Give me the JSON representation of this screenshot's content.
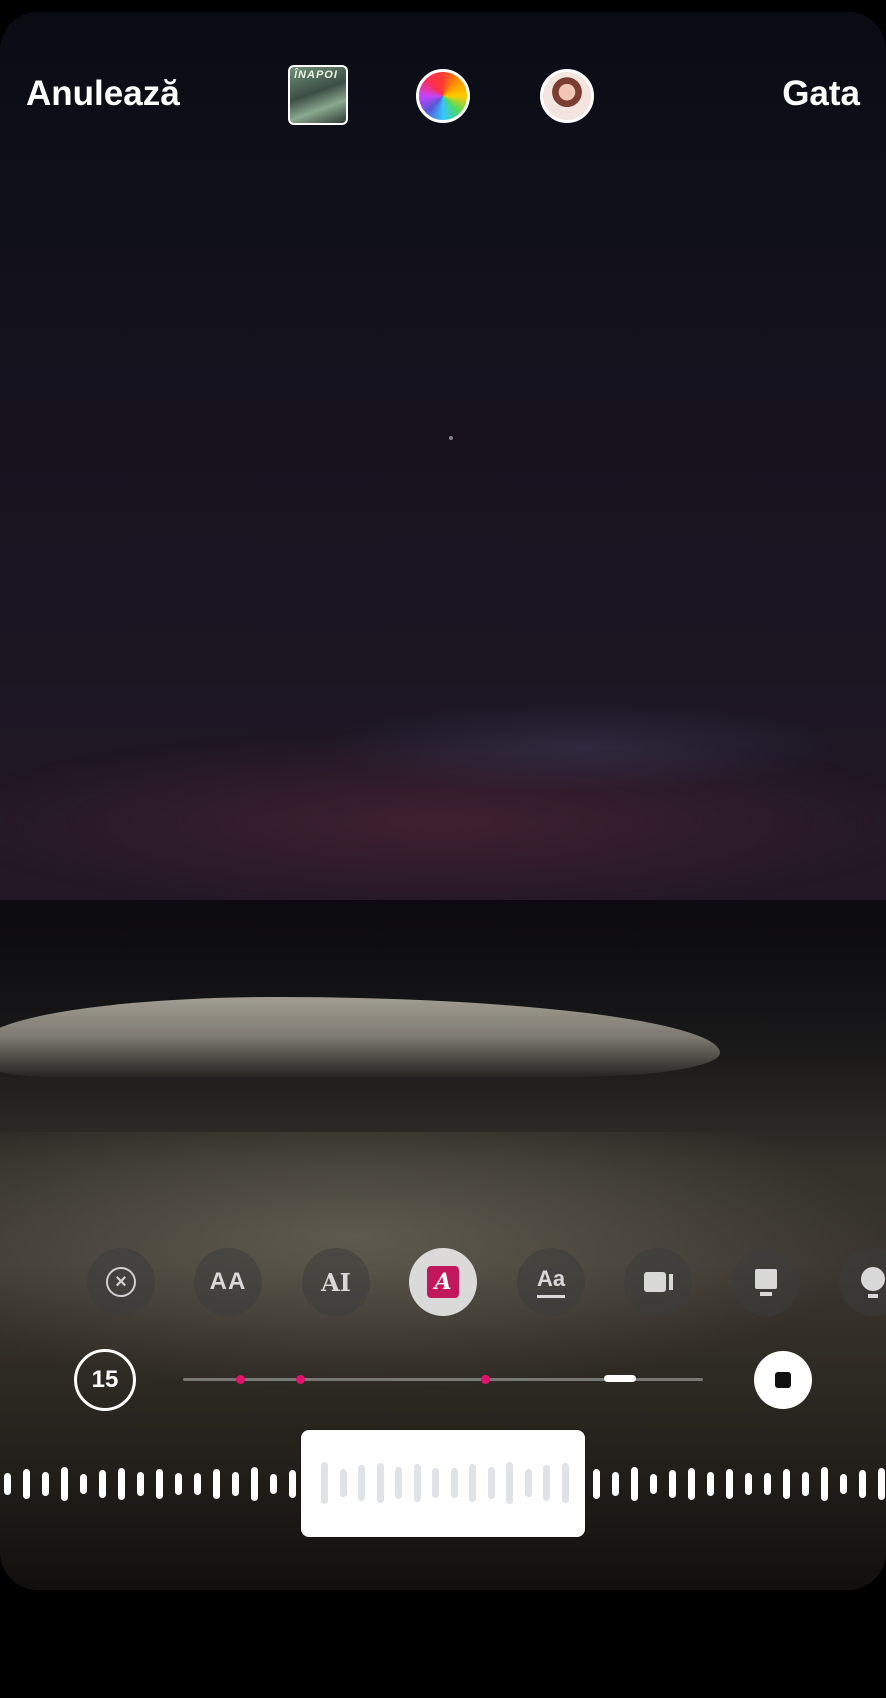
{
  "header": {
    "cancel_label": "Anulează",
    "done_label": "Gata",
    "thumbnail_text": "ÎNAPOI"
  },
  "toolbar": {
    "items": [
      "remove-icon",
      "text-size-icon",
      "text-highlight-icon",
      "text-style-box-icon",
      "text-underline-icon",
      "camera-icon",
      "card-icon",
      "bulb-icon"
    ],
    "selected": "text-style-box-icon",
    "aa_label": "AA",
    "ai_label": "AI",
    "a_label": "A",
    "aa_small_label": "Aa"
  },
  "timeline": {
    "duration": "15",
    "marker_positions": [
      0.11,
      0.225,
      0.58
    ],
    "progress_position": 0.84
  },
  "colors": {
    "accent": "#e3116c",
    "selected_tool_bg": "#c2185b"
  }
}
